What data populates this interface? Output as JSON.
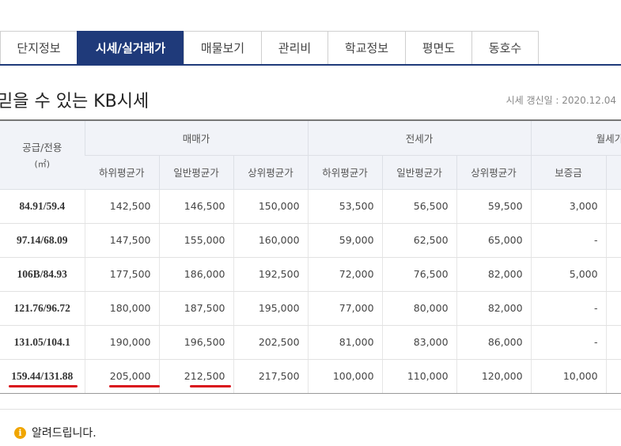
{
  "tabs": [
    {
      "label": "단지정보",
      "active": false
    },
    {
      "label": "시세/실거래가",
      "active": true
    },
    {
      "label": "매물보기",
      "active": false
    },
    {
      "label": "관리비",
      "active": false
    },
    {
      "label": "학교정보",
      "active": false
    },
    {
      "label": "평면도",
      "active": false
    },
    {
      "label": "동호수",
      "active": false
    }
  ],
  "heading": "믿을 수 있는 KB시세",
  "updated": "시세 갱신일 : 2020.12.04",
  "table": {
    "area_header": "공급/전용",
    "area_unit": "(㎡)",
    "groups": [
      "매매가",
      "전세가",
      "월세가"
    ],
    "subheaders": [
      "하위평균가",
      "일반평균가",
      "상위평균가",
      "하위평균가",
      "일반평균가",
      "상위평균가",
      "보증금",
      ""
    ],
    "rows": [
      [
        "84.91/59.4",
        "142,500",
        "146,500",
        "150,000",
        "53,500",
        "56,500",
        "59,500",
        "3,000",
        ""
      ],
      [
        "97.14/68.09",
        "147,500",
        "155,000",
        "160,000",
        "59,000",
        "62,500",
        "65,000",
        "-",
        ""
      ],
      [
        "106B/84.93",
        "177,500",
        "186,000",
        "192,500",
        "72,000",
        "76,500",
        "82,000",
        "5,000",
        ""
      ],
      [
        "121.76/96.72",
        "180,000",
        "187,500",
        "195,000",
        "77,000",
        "80,000",
        "82,000",
        "-",
        ""
      ],
      [
        "131.05/104.1",
        "190,000",
        "196,500",
        "202,500",
        "81,000",
        "83,000",
        "86,000",
        "-",
        ""
      ],
      [
        "159.44/131.88",
        "205,000",
        "212,500",
        "217,500",
        "100,000",
        "110,000",
        "120,000",
        "10,000",
        ""
      ]
    ]
  },
  "notice": {
    "icon": "info-icon",
    "text": "알려드립니다."
  },
  "colors": {
    "accent": "#1f3a7a",
    "highlight": "#d9121b",
    "info": "#f0a500"
  }
}
